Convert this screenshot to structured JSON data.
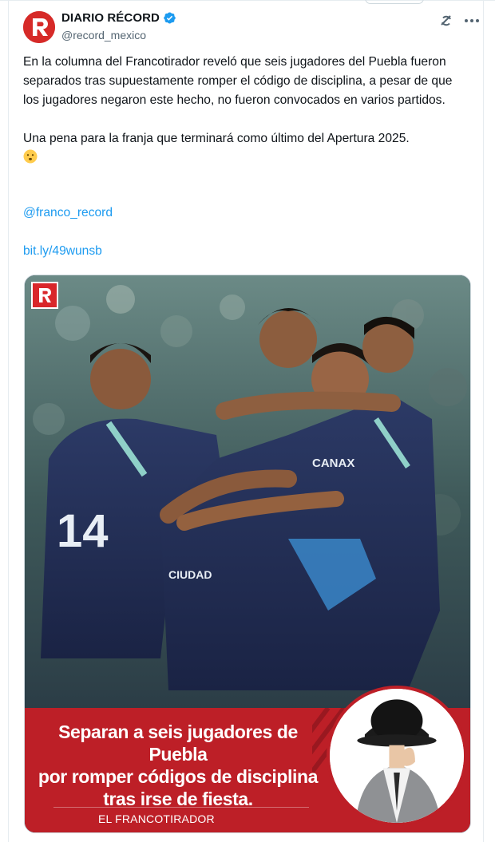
{
  "author": {
    "display_name": "DIARIO RÉCORD",
    "handle": "@record_mexico",
    "avatar_letter": "R",
    "brand_color": "#d62a28",
    "verified_color": "#1d9bf0"
  },
  "tweet": {
    "paragraph_1": "En la columna del Francotirador reveló que seis jugadores del Puebla fueron separados tras supuestamente romper el código de disciplina, a pesar de que los jugadores negaron este hecho, no fueron convocados en varios partidos.",
    "paragraph_2": "Una pena para la franja que terminará como último del Apertura 2025.",
    "emoji": "face-with-open-mouth-emoji",
    "mention": "@franco_record",
    "link": "bit.ly/49wunsb",
    "link_color": "#1d9bf0"
  },
  "media": {
    "logo_letter": "R",
    "headline_lines": [
      "Separan a seis jugadores de Puebla",
      "por romper códigos de disciplina",
      "tras irse de fiesta."
    ],
    "byline": "EL FRANCOTIRADOR",
    "banner_color": "#bd1f27"
  },
  "icons": {
    "grok": "grok-icon",
    "more": "more-options-icon",
    "verified": "verified-badge-icon"
  }
}
